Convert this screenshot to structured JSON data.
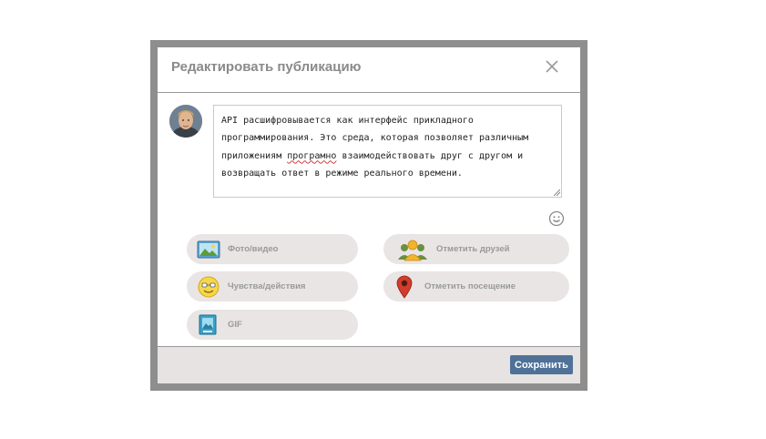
{
  "dialog": {
    "title": "Редактировать публикацию",
    "close_icon": "close-icon"
  },
  "post": {
    "text_part1": "API расшифровывается как интерфейс прикладного программирования. Это среда, которая позволяет различным приложениям ",
    "text_misspelled": "програмно",
    "text_part2": " взаимодействовать друг с другом и возвращать ответ в режиме реального времени."
  },
  "actions": [
    {
      "label": "Фото/видео",
      "icon": "photo-icon"
    },
    {
      "label": "Отметить друзей",
      "icon": "friends-icon"
    },
    {
      "label": "Чувства/действия",
      "icon": "smiley-face-icon"
    },
    {
      "label": "Отметить посещение",
      "icon": "map-pin-icon"
    },
    {
      "label": "GIF",
      "icon": "gif-icon"
    }
  ],
  "footer": {
    "save_label": "Сохранить"
  },
  "colors": {
    "save_button": "#4f7198",
    "pill_background": "#e8e5e4",
    "footer_background": "#e6e3e2",
    "frame": "#8e8e8e"
  }
}
